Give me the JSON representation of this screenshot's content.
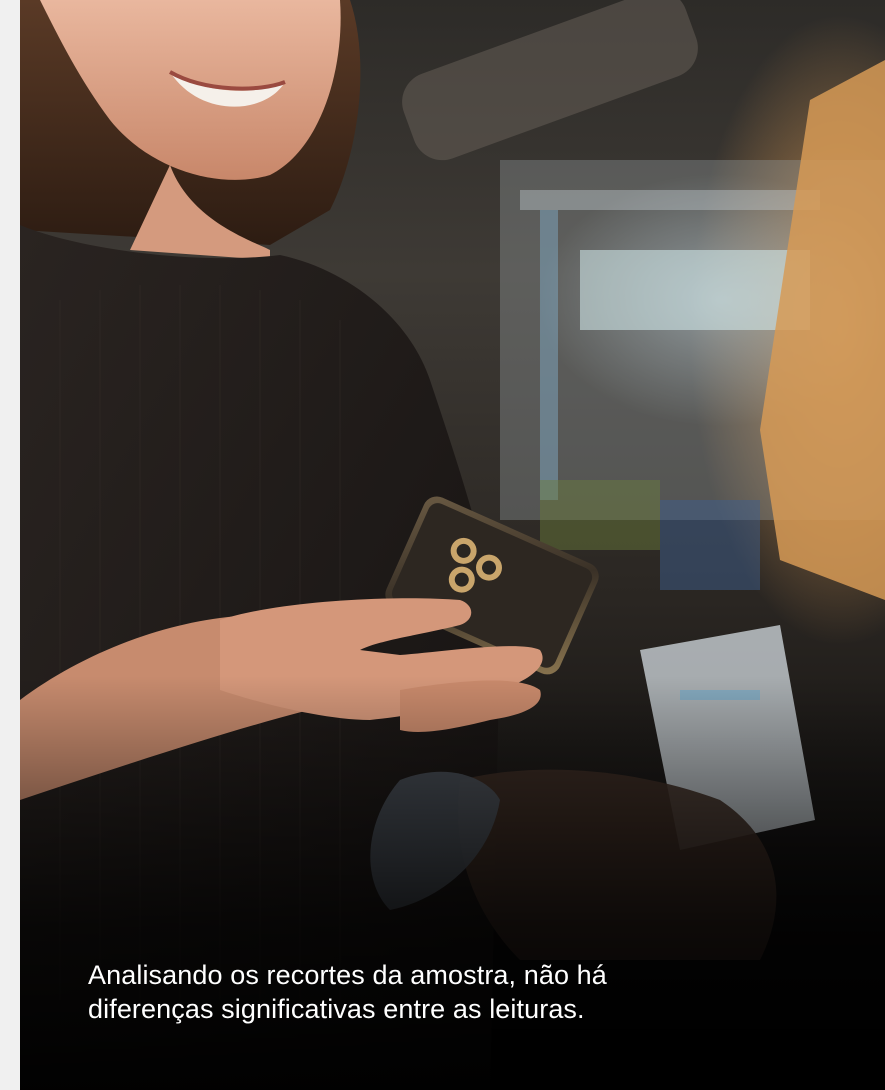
{
  "slide": {
    "caption_line1": "Analisando os recortes da amostra, não há",
    "caption_line2": "diferenças significativas entre as leituras.",
    "caption_color": "#ffffff",
    "background_color": "#f2f2f2"
  }
}
